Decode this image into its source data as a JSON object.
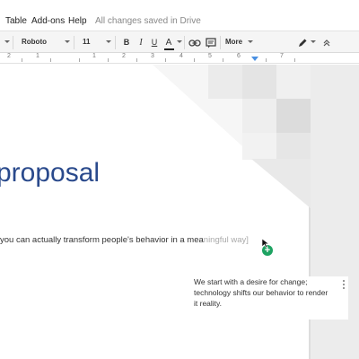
{
  "menubar": {
    "items": [
      "Table",
      "Add-ons",
      "Help"
    ],
    "save_status": "All changes saved in Drive"
  },
  "toolbar": {
    "font": "Roboto",
    "size": "11",
    "bold": "B",
    "italic": "I",
    "underline": "U",
    "text_color": "A",
    "more": "More",
    "icons": [
      "caret-down-icon",
      "link-icon",
      "comment-icon",
      "pen-icon",
      "collapse-icon"
    ]
  },
  "ruler": {
    "numbers": [
      "2",
      "1",
      "1",
      "2",
      "3",
      "4",
      "5",
      "6",
      "7"
    ]
  },
  "document": {
    "title": "proposal",
    "body_text": "you can actually transform people's behavior in a mea",
    "body_faded": "ningful way]"
  },
  "comment": {
    "text": "We start with a desire for change; technology shifts our behavior to render it reality."
  },
  "colors": {
    "title_blue": "#2a4a8c",
    "add_button_green": "#1ea362",
    "ruler_marker": "#4a90e2"
  }
}
